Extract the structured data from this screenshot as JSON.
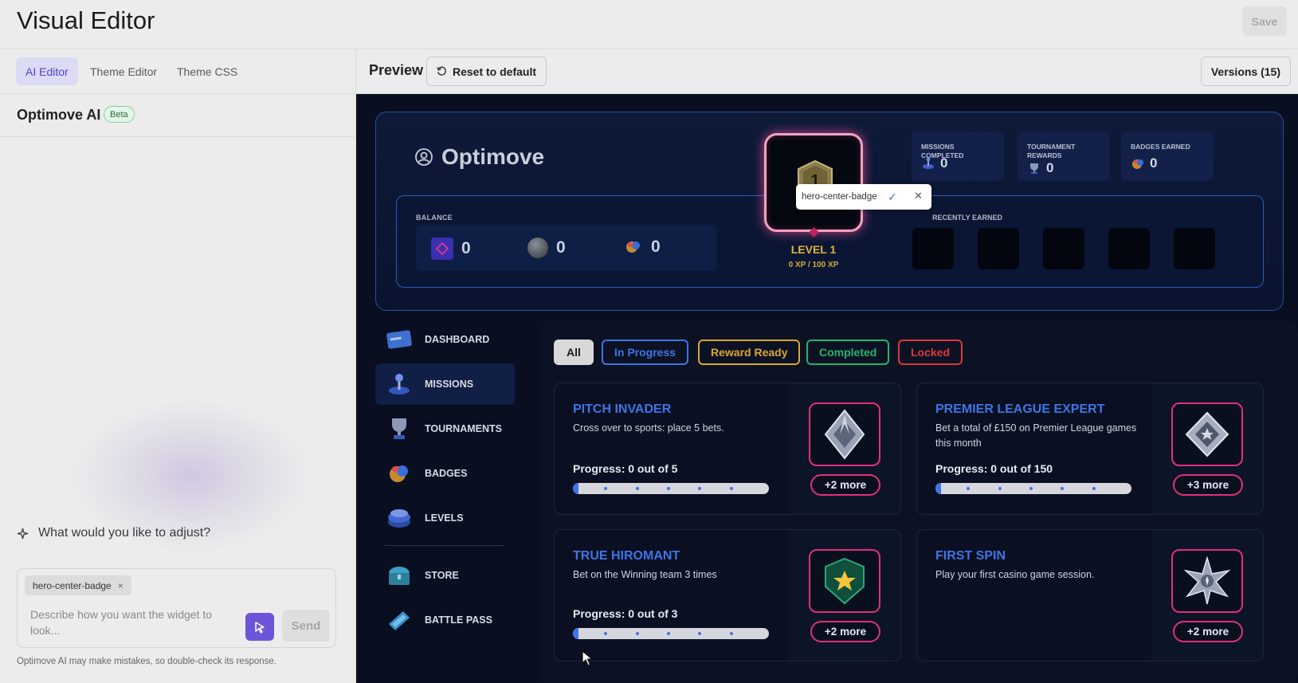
{
  "app": {
    "title": "Visual Editor",
    "save_label": "Save"
  },
  "left_tabs": [
    {
      "label": "AI Editor",
      "active": true
    },
    {
      "label": "Theme Editor",
      "active": false
    },
    {
      "label": "Theme CSS",
      "active": false
    }
  ],
  "ai": {
    "name": "Optimove AI",
    "beta": "Beta",
    "prompt": "What would you like to adjust?",
    "chip": "hero-center-badge",
    "chip_close": "×",
    "placeholder": "Describe how you want the widget to look...",
    "send": "Send",
    "disclaimer": "Optimove AI may make mistakes, so double-check its response."
  },
  "preview": {
    "label": "Preview",
    "reset": "Reset to default",
    "versions": "Versions (15)"
  },
  "hero": {
    "brand": "Optimove",
    "balance_label": "BALANCE",
    "balances": [
      "0",
      "0",
      "0"
    ],
    "level_badge_number": "1",
    "level": "LEVEL 1",
    "xp": "0 XP / 100 XP",
    "tooltip": "hero-center-badge",
    "stats": [
      {
        "title": "MISSIONS COMPLETED",
        "value": "0"
      },
      {
        "title": "TOURNAMENT REWARDS",
        "value": "0"
      },
      {
        "title": "BADGES EARNED",
        "value": "0"
      }
    ],
    "recently_earned": "RECENTLY EARNED"
  },
  "nav": [
    {
      "label": "DASHBOARD",
      "icon": "dashboard-card-icon"
    },
    {
      "label": "MISSIONS",
      "icon": "joystick-icon",
      "active": true
    },
    {
      "label": "TOURNAMENTS",
      "icon": "trophy-icon"
    },
    {
      "label": "BADGES",
      "icon": "badge-icon"
    },
    {
      "label": "LEVELS",
      "icon": "levels-stack-icon"
    },
    {
      "label": "STORE",
      "icon": "chest-icon"
    },
    {
      "label": "BATTLE PASS",
      "icon": "ticket-icon"
    }
  ],
  "filters": [
    {
      "label": "All",
      "color": "#1a1a1a"
    },
    {
      "label": "In Progress",
      "color": "#3f74e8"
    },
    {
      "label": "Reward Ready",
      "color": "#d9a730"
    },
    {
      "label": "Completed",
      "color": "#26b36a"
    },
    {
      "label": "Locked",
      "color": "#e0363c"
    }
  ],
  "missions": [
    {
      "title": "PITCH INVADER",
      "desc": "Cross over to sports: place 5 bets.",
      "progress": "Progress: 0 out of 5",
      "fraction": 0,
      "more": "+2 more",
      "icon": "silver-diamond-badge-icon"
    },
    {
      "title": "PREMIER LEAGUE EXPERT",
      "desc": "Bet a total of £150 on Premier League games this month",
      "progress": "Progress: 0 out of 150",
      "fraction": 0,
      "more": "+3 more",
      "icon": "silver-star-diamond-icon"
    },
    {
      "title": "TRUE HIROMANT",
      "desc": "Bet on the Winning team 3 times",
      "progress": "Progress: 0 out of 3",
      "fraction": 0,
      "more": "+2 more",
      "icon": "green-star-shield-icon"
    },
    {
      "title": "FIRST SPIN",
      "desc": "Play your first casino game session.",
      "progress": "",
      "fraction": null,
      "more": "+2 more",
      "icon": "silver-spiked-star-icon"
    }
  ]
}
